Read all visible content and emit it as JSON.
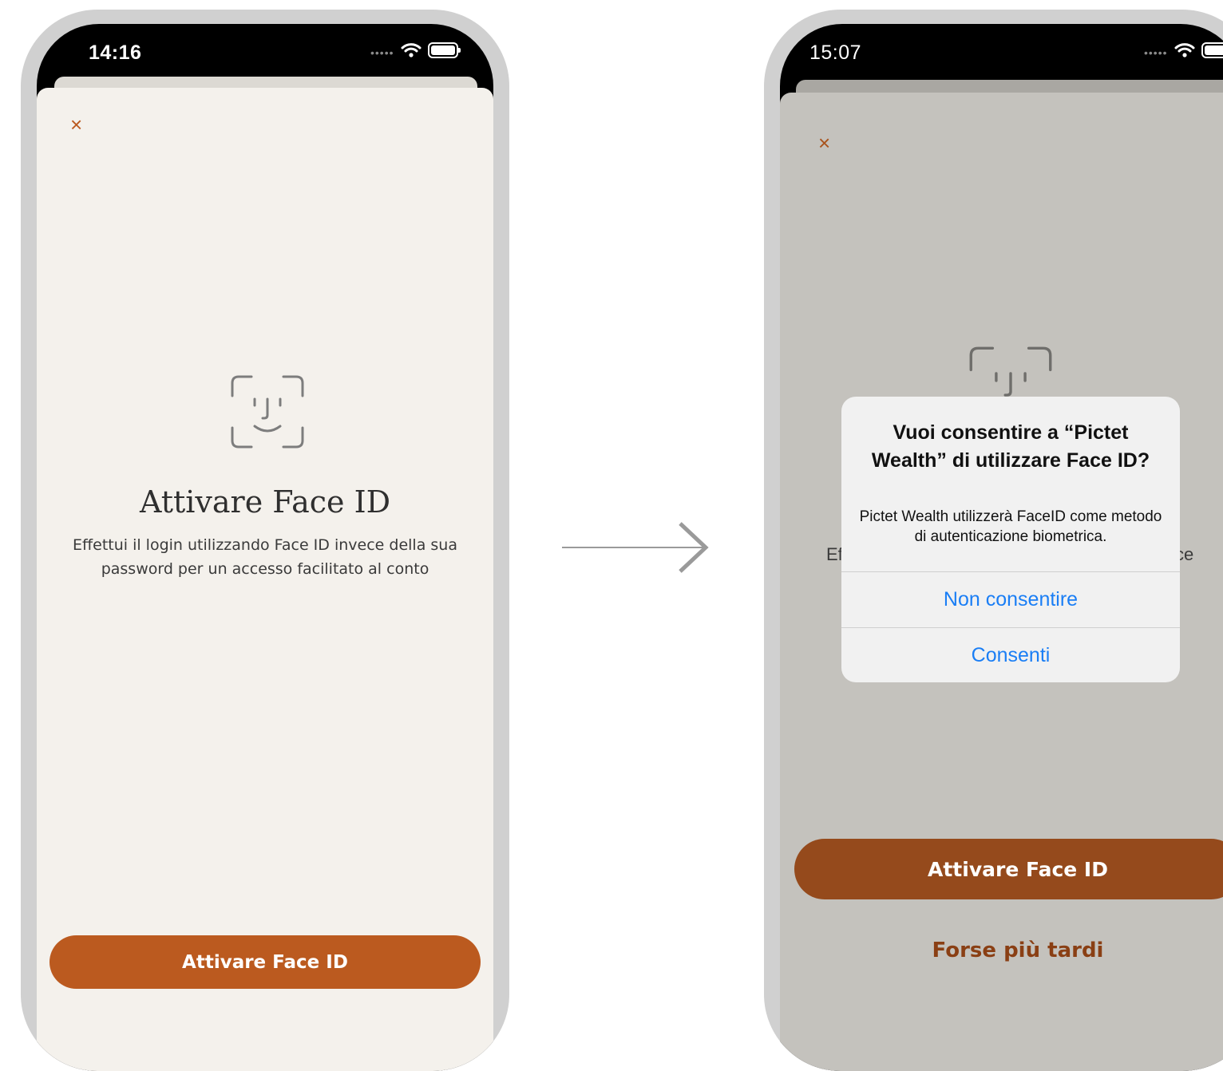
{
  "colors": {
    "accent": "#bb5a1f",
    "accent_dim": "#954a1c",
    "sheet_bg": "#f4f1ec",
    "dim_bg": "#c4c2bd",
    "ios_blue": "#1a7ef5"
  },
  "screen1": {
    "status_time": "14:16",
    "close_icon": "×",
    "face_icon": "faceid-icon",
    "title": "Attivare Face ID",
    "description": "Effettui il login utilizzando Face ID invece della sua password per un accesso facilitato al conto",
    "button_label": "Attivare Face ID"
  },
  "screen2": {
    "status_time": "15:07",
    "close_icon": "×",
    "face_icon": "faceid-icon",
    "partial_left_text": "Ef",
    "partial_right_text": "ce",
    "button_label": "Attivare Face ID",
    "later_label": "Forse più tardi",
    "dialog": {
      "title": "Vuoi consentire a “Pictet Wealth” di utilizzare Face ID?",
      "message": "Pictet Wealth utilizzerà FaceID come metodo di autenticazione biometrica.",
      "deny_label": "Non consentire",
      "allow_label": "Consenti"
    }
  },
  "flow_arrow_icon": "arrow-right-icon"
}
